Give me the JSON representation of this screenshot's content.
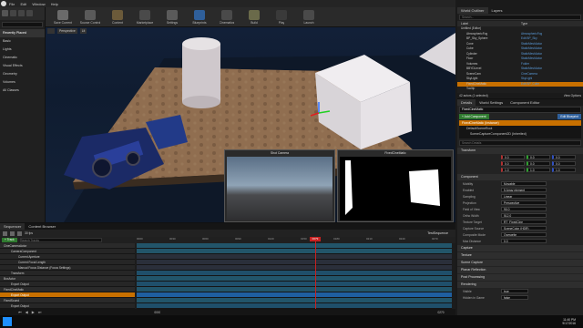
{
  "menu": [
    "File",
    "Edit",
    "Window",
    "Help"
  ],
  "toolbar": {
    "buttons": [
      {
        "label": "Save Current",
        "icon": "save-icon",
        "color": "#6a6a6a"
      },
      {
        "label": "Source Control",
        "icon": "source-control-icon",
        "color": "#5a5a5a"
      },
      {
        "label": "Content",
        "icon": "content-icon",
        "color": "#6b5a3a"
      },
      {
        "label": "Marketplace",
        "icon": "marketplace-icon",
        "color": "#4a4a4a"
      },
      {
        "label": "Settings",
        "icon": "gear-icon",
        "color": "#5a5a5a"
      },
      {
        "label": "Blueprints",
        "icon": "blueprint-icon",
        "color": "#2f5f9a"
      },
      {
        "label": "Cinematics",
        "icon": "clapper-icon",
        "color": "#4a4a4a"
      },
      {
        "label": "Build",
        "icon": "build-icon",
        "color": "#6a6a4a"
      },
      {
        "label": "Play",
        "icon": "play-icon",
        "color": "#3a3a3a"
      },
      {
        "label": "Launch",
        "icon": "launch-icon",
        "color": "#4a4a4a"
      }
    ]
  },
  "left_panel": {
    "header": "Recently Placed",
    "items": [
      "Basic",
      "Lights",
      "Cinematic",
      "Visual Effects",
      "Geometry",
      "Volumes",
      "All Classes"
    ]
  },
  "viewport": {
    "mode": "Perspective",
    "view": "Lit",
    "pip_left_title": "Shot Camera",
    "pip_right_title": "FixedCineMatic"
  },
  "outliner": {
    "tabs": [
      "World Outliner",
      "Layers"
    ],
    "search": "Search...",
    "col_label": "Label",
    "col_type": "Type",
    "rows": [
      {
        "label": "Untitled (Editor)",
        "type": ""
      },
      {
        "label": "AtmosphericFog",
        "type": "AtmosphericFog"
      },
      {
        "label": "BP_Sky_Sphere",
        "type": "Edit BP_Sky"
      },
      {
        "label": "Cone",
        "type": "StaticMeshActor"
      },
      {
        "label": "Cube",
        "type": "StaticMeshActor"
      },
      {
        "label": "Cylinder",
        "type": "StaticMeshActor"
      },
      {
        "label": "Floor",
        "type": "StaticMeshActor"
      },
      {
        "label": "Volumes",
        "type": "Folder"
      },
      {
        "label": "BBYDLevel",
        "type": "StaticMeshActor"
      },
      {
        "label": "SceneCam",
        "type": "CineCamera"
      },
      {
        "label": "SkyLight",
        "type": "SkyLight"
      },
      {
        "label": "FixedCineMatic",
        "type": "Edit BP_Cube"
      },
      {
        "label": "Tooltip",
        "type": ""
      }
    ],
    "footer": "42 actors (1 selected)",
    "view_options": "View Options"
  },
  "details": {
    "tabs": [
      "Details",
      "World Settings",
      "Component Editor"
    ],
    "actor_name": "FixedCineMatic",
    "add_component": "+ Add Component",
    "edit_blueprint": "Edit Blueprint",
    "components": [
      "FixedCineMatic (Instance)",
      "DefaultSceneRoot",
      "SceneCaptureComponent2D (Inherited)"
    ],
    "search": "Search Details",
    "transform": {
      "section": "Transform",
      "location": [
        "0.0",
        "0.0",
        "0.0"
      ],
      "rotation": [
        "0.0",
        "0.0",
        "0.0"
      ],
      "scale": [
        "1.0",
        "1.0",
        "1.0"
      ]
    },
    "component_section": "Component",
    "props": [
      {
        "k": "Mobility",
        "v": "Movable"
      },
      {
        "k": "Enabled",
        "v": "5 Array element"
      },
      {
        "k": "Sampling",
        "v": "Linear"
      },
      {
        "k": "Projection",
        "v": "Perspective"
      },
      {
        "k": "Field of View",
        "v": "90.0"
      },
      {
        "k": "Ortho Width",
        "v": "512.0"
      },
      {
        "k": "Texture Target",
        "v": "RT_FixedCine"
      },
      {
        "k": "Capture Source",
        "v": "SceneColor (HDR)"
      },
      {
        "k": "Composite Mode",
        "v": "Overwrite"
      },
      {
        "k": "Max Distance",
        "v": "0.0"
      }
    ],
    "sections": [
      "Capture",
      "Texture",
      "Scene Capture",
      "Planar Reflection",
      "Post Processing",
      "Rendering"
    ],
    "rendering": [
      {
        "k": "Visible",
        "v": "true"
      },
      {
        "k": "Hidden in Game",
        "v": "false"
      }
    ]
  },
  "sequencer": {
    "tabs": [
      "Sequencer",
      "Content Browser"
    ],
    "track_button": "+ Track",
    "filter": "Search Tracks",
    "fps": "30 fps",
    "sequence_name": "TestSequence",
    "playhead": "0079",
    "time_ticks": [
      "0000",
      "0030",
      "0060",
      "0090",
      "0120",
      "0150",
      "0180",
      "0210",
      "0240",
      "0270"
    ],
    "tracks": [
      {
        "label": "CineCameraActor",
        "indent": 0,
        "color": "#2a2a2a",
        "bar": "#22556a"
      },
      {
        "label": "CameraComponent",
        "indent": 1,
        "color": "#262626",
        "bar": "#22556a"
      },
      {
        "label": "Current Aperture",
        "indent": 2,
        "color": "#262626",
        "bar": "#2a2f3a"
      },
      {
        "label": "Current Focal Length",
        "indent": 2,
        "color": "#262626",
        "bar": "#2a2f3a"
      },
      {
        "label": "Manual Focus Distance (Focus Settings)",
        "indent": 2,
        "color": "#262626",
        "bar": "#2a2f3a"
      },
      {
        "label": "Transform",
        "indent": 1,
        "color": "#262626",
        "bar": "#1f4f6a"
      },
      {
        "label": "BoxActor",
        "indent": 0,
        "color": "#2a2a2a",
        "bar": "#22556a"
      },
      {
        "label": "Export Output",
        "indent": 1,
        "color": "#262626",
        "bar": "#1f4f6a"
      },
      {
        "label": "FixedCineMatic",
        "indent": 0,
        "color": "#2a2a2a",
        "bar": "#22556a"
      },
      {
        "label": "Export Output",
        "indent": 1,
        "color": "#c87000",
        "bar": "#1f5fa0"
      },
      {
        "label": "FixedSound",
        "indent": 0,
        "color": "#2a2a2a",
        "bar": "#22556a"
      },
      {
        "label": "Export Output",
        "indent": 1,
        "color": "#262626",
        "bar": "#1f4f6a"
      }
    ],
    "time_in": "0000",
    "time_out": "0270"
  },
  "taskbar": {
    "time": "11:40 PM",
    "date": "9/17/2016"
  },
  "colors": {
    "accent": "#c87000",
    "viewport_floor": "#8a6a4a",
    "selection": "#2f6fbf"
  }
}
